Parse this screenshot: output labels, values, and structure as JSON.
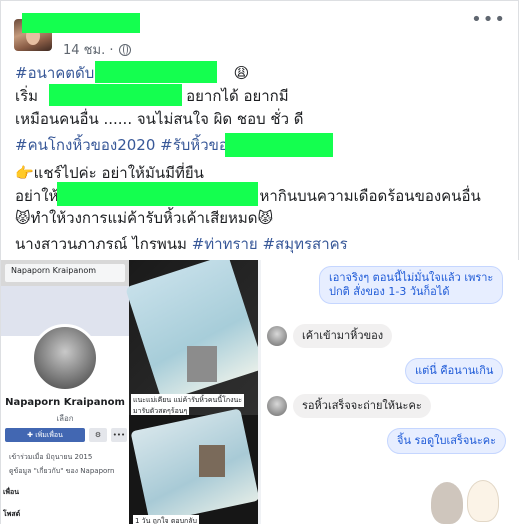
{
  "post": {
    "timestamp": "14 ชม. ·",
    "globe_icon": "globe-icon",
    "more_icon": "more-options-icon",
    "lines": {
      "l1_tag": "#อนาคตดับ #",
      "l1_emoji": "😩",
      "l2a": "เริ่ม",
      "l2b": "น อยากได้ อยากมี",
      "l3": "เหมือนคนอื่น ...... จนไม่สนใจ ผิด ชอบ ชั่ว ดี",
      "l4": "#คนโกงหิ้วของ2020 #รับหิ้วของ",
      "l5": "👉แชร์ไปค่ะ อย่าให้มันมีที่ยืน",
      "l6a": "อย่าให้",
      "l6b": "หากินบนความเดือดร้อนของคนอื่น",
      "l7": "😾ทำให้วงการแม่ค้ารับหิ้วเค้าเสียหมด😾",
      "l8_name": "นางสาวนภาภรณ์ ไกรพนม ",
      "l8_tags": "#ท่าทราย #สมุทรสาคร"
    }
  },
  "photo_left": {
    "search_text": "Napaporn Kraipanom",
    "profile_name": "Napaporn Kraipanom",
    "profile_sub": "เลือก",
    "add_friend": "✚ เพิ่มเพื่อน",
    "msg_btn": "⚙",
    "more_btn": "•••",
    "info_1": "เข้าร่วมเมื่อ มิถุนายน 2015",
    "info_2": "ดูข้อมูล \"เกี่ยวกับ\" ของ Napaporn",
    "section_friends": "เพื่อน",
    "section_posts": "โพสต์",
    "caption_a1": "แนะแม่เคียน แม่ค้ารับหิ้วคนนี้โกงนะ",
    "caption_a2": "มารับตัวสดๆร้อนๆ",
    "caption_b": "1 วัน  ถูกใจ  ตอบกลับ"
  },
  "photo_right": {
    "msg1": "เอาจริงๆ ตอนนี้ไม่มั่นใจแล้ว เพราะ",
    "msg1b": "ปกติ สั่งของ 1-3 วันก็อได้",
    "msg2": "เค้าเข้ามาหิ้วของ",
    "msg3": "แต่นี่ คือนานเกิน",
    "msg4": "รอหิ้วเสร็จจะถ่ายให้นะคะ",
    "msg5": "จิ้น รอดูใบเสร็จนะคะ"
  }
}
